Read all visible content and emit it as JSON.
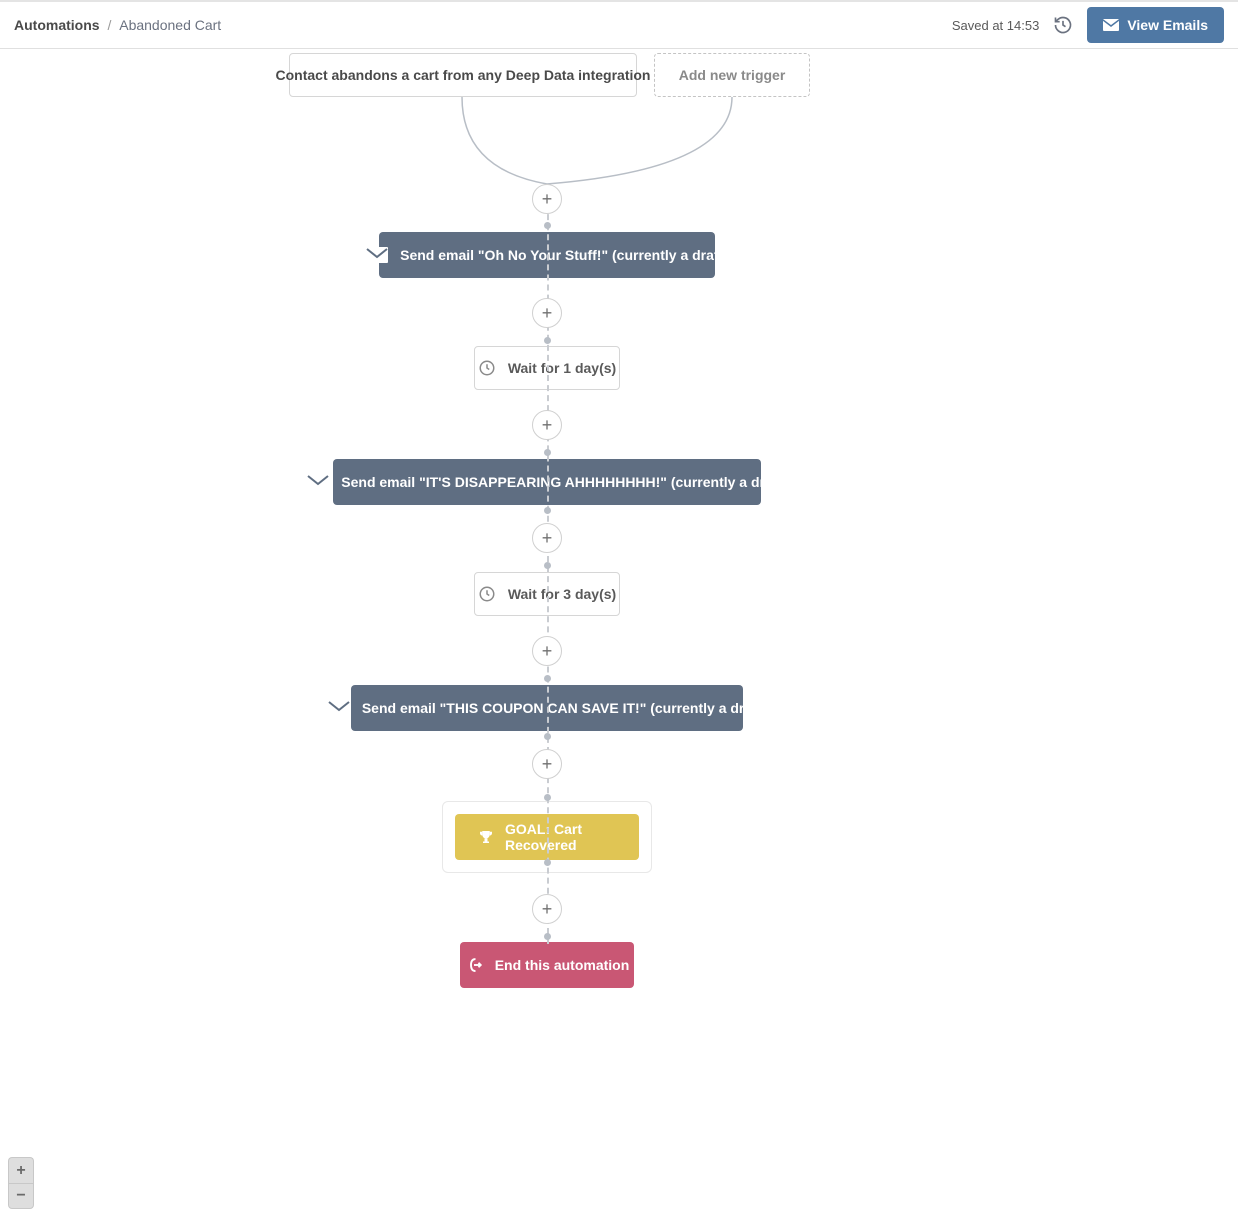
{
  "header": {
    "breadcrumb_root": "Automations",
    "breadcrumb_sep": "/",
    "breadcrumb_current": "Abandoned Cart",
    "saved_label": "Saved at 14:53",
    "view_emails_label": "View Emails"
  },
  "nodes": {
    "trigger": "Contact abandons a cart from any Deep Data integration",
    "add_trigger": "Add new trigger",
    "email1": "Send email \"Oh No Your Stuff!\" (currently a draft)",
    "wait1": "Wait for 1 day(s)",
    "email2": "Send email \"IT'S DISAPPEARING AHHHHHHHH!\" (currently a draft)",
    "wait2": "Wait for 3 day(s)",
    "email3": "Send email \"THIS COUPON CAN SAVE IT!\" (currently a draft)",
    "goal": "GOAL: Cart Recovered",
    "end": "End this automation"
  },
  "zoom": {
    "in": "+",
    "out": "−"
  },
  "colors": {
    "email_node": "#5f6e82",
    "goal_node": "#e0c554",
    "end_node": "#c95774",
    "primary_button": "#4f78a4"
  }
}
